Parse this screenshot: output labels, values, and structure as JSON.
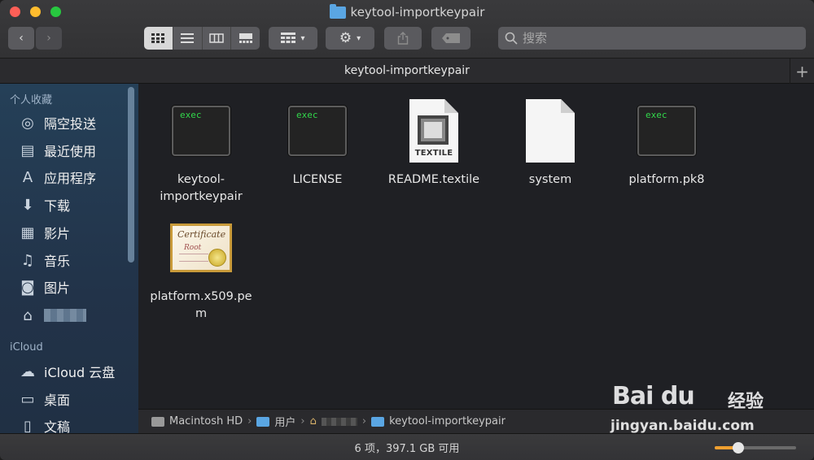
{
  "window": {
    "title": "keytool-importkeypair"
  },
  "toolbar": {
    "back_glyph": "‹",
    "forward_glyph": "›",
    "view_modes": [
      "icon-view",
      "list-view",
      "column-view",
      "gallery-view"
    ],
    "search_placeholder": "搜索"
  },
  "tabbar": {
    "label": "keytool-importkeypair",
    "add_glyph": "+"
  },
  "sidebar": {
    "favorites_title": "个人收藏",
    "favorites": [
      {
        "label": "隔空投送",
        "icon": "airdrop-icon",
        "glyph": "◎"
      },
      {
        "label": "最近使用",
        "icon": "recents-icon",
        "glyph": "▤"
      },
      {
        "label": "应用程序",
        "icon": "applications-icon",
        "glyph": "A"
      },
      {
        "label": "下载",
        "icon": "downloads-icon",
        "glyph": "⬇"
      },
      {
        "label": "影片",
        "icon": "movies-icon",
        "glyph": "▦"
      },
      {
        "label": "音乐",
        "icon": "music-icon",
        "glyph": "♫"
      },
      {
        "label": "图片",
        "icon": "pictures-icon",
        "glyph": "◙"
      }
    ],
    "icloud_title": "iCloud",
    "icloud": [
      {
        "label": "iCloud 云盘",
        "icon": "icloud-drive-icon",
        "glyph": "☁"
      },
      {
        "label": "桌面",
        "icon": "desktop-icon",
        "glyph": "▭"
      },
      {
        "label": "文稿",
        "icon": "documents-icon",
        "glyph": "▯"
      }
    ]
  },
  "files": [
    {
      "name": "keytool-\nimportkeypair",
      "kind": "exec",
      "badge": "exec"
    },
    {
      "name": "LICENSE",
      "kind": "exec",
      "badge": "exec"
    },
    {
      "name": "README.textile",
      "kind": "textile",
      "badge": "TEXTILE"
    },
    {
      "name": "system",
      "kind": "blank"
    },
    {
      "name": "platform.pk8",
      "kind": "exec",
      "badge": "exec"
    },
    {
      "name": "platform.x509.pe\nm",
      "kind": "cert",
      "cert_title": "Certificate",
      "cert_sub": "Root"
    }
  ],
  "pathbar": {
    "items": [
      "Macintosh HD",
      "用户",
      "keytool-importkeypair"
    ],
    "separator": "›"
  },
  "statusbar": {
    "summary": "6 项，397.1 GB 可用",
    "zoom_level": 0.25
  },
  "watermark": {
    "logo": "Bai du",
    "cn": "经验",
    "url": "jingyan.baidu.com"
  }
}
